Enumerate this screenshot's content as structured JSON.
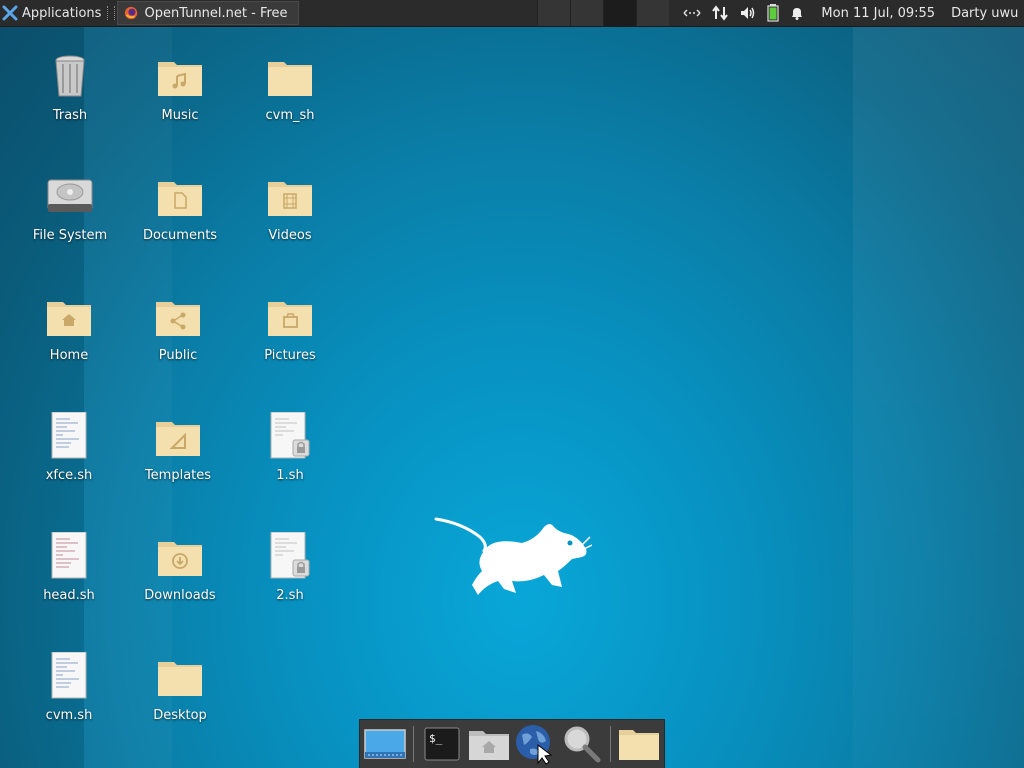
{
  "panel": {
    "applications_label": "Applications",
    "task_title": "OpenTunnel.net - Free S...",
    "clock": "Mon 11 Jul, 09:55",
    "user": "Darty uwu",
    "workspace_count": 4,
    "active_workspace": 3
  },
  "desktop": {
    "icons": [
      {
        "label": "Trash",
        "type": "trash"
      },
      {
        "label": "Music",
        "type": "folder-music"
      },
      {
        "label": "cvm_sh",
        "type": "folder"
      },
      {
        "label": "File System",
        "type": "drive"
      },
      {
        "label": "Documents",
        "type": "folder-documents"
      },
      {
        "label": "Videos",
        "type": "folder-videos"
      },
      {
        "label": "Home",
        "type": "folder-home"
      },
      {
        "label": "Public",
        "type": "folder-public"
      },
      {
        "label": "Pictures",
        "type": "folder-pictures"
      },
      {
        "label": "xfce.sh",
        "type": "script"
      },
      {
        "label": "Templates",
        "type": "folder-templates"
      },
      {
        "label": "1.sh",
        "type": "script-locked"
      },
      {
        "label": "head.sh",
        "type": "script"
      },
      {
        "label": "Downloads",
        "type": "folder-downloads"
      },
      {
        "label": "2.sh",
        "type": "script-locked"
      },
      {
        "label": "cvm.sh",
        "type": "script"
      },
      {
        "label": "Desktop",
        "type": "folder"
      }
    ]
  },
  "dock": {
    "items": [
      "show-desktop",
      "terminal",
      "home-folder",
      "web-browser",
      "app-finder",
      "file-manager"
    ]
  },
  "colors": {
    "panel_bg": "#2b2b2b",
    "desktop_center": "#08a7d8",
    "folder": "#f2dcaa"
  }
}
